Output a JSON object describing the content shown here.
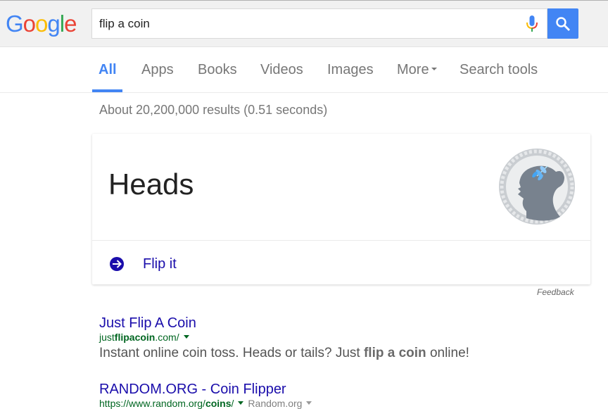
{
  "header": {
    "logo_letters": [
      {
        "ch": "G",
        "color": "#4285f4"
      },
      {
        "ch": "o",
        "color": "#ea4335"
      },
      {
        "ch": "o",
        "color": "#fbbc05"
      },
      {
        "ch": "g",
        "color": "#4285f4"
      },
      {
        "ch": "l",
        "color": "#34a853"
      },
      {
        "ch": "e",
        "color": "#ea4335"
      }
    ],
    "search_query": "flip a coin",
    "mic_icon": "microphone-icon",
    "search_icon": "search-icon",
    "accent": "#4285f4"
  },
  "tabs": [
    {
      "label": "All",
      "active": true
    },
    {
      "label": "Apps",
      "active": false
    },
    {
      "label": "Books",
      "active": false
    },
    {
      "label": "Videos",
      "active": false
    },
    {
      "label": "Images",
      "active": false
    },
    {
      "label": "More",
      "active": false,
      "dropdown": true
    },
    {
      "label": "Search tools",
      "active": false
    }
  ],
  "stats": "About 20,200,000 results (0.51 seconds)",
  "coin_card": {
    "result": "Heads",
    "coin_icon": "coin-heads-icon",
    "flip_label": "Flip it",
    "flip_icon": "arrow-right-circle-icon"
  },
  "feedback": "Feedback",
  "results": [
    {
      "title": "Just Flip A Coin",
      "url_pre": "just",
      "url_bold": "flipacoin",
      "url_post": ".com/",
      "snippet_pre": "Instant online coin toss. Heads or tails? Just ",
      "snippet_bold": "flip a coin",
      "snippet_post": " online!"
    },
    {
      "title": "RANDOM.ORG - Coin Flipper",
      "url_pre": "https://www.random.org/",
      "url_bold": "coins",
      "url_post": "/",
      "source": "Random.org"
    }
  ]
}
